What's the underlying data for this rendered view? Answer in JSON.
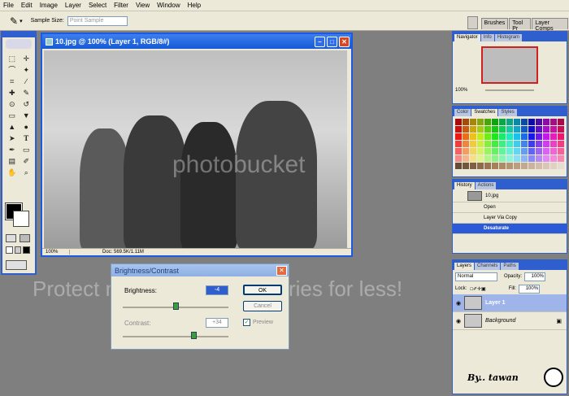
{
  "menu": [
    "File",
    "Edit",
    "Image",
    "Layer",
    "Select",
    "Filter",
    "View",
    "Window",
    "Help"
  ],
  "options": {
    "sample_size_label": "Sample Size:",
    "sample_size_value": "Point Sample"
  },
  "dock_tabs": [
    "Brushes",
    "Tool Pr",
    "Layer Comps"
  ],
  "document": {
    "title": "10.jpg @ 100% (Layer 1, RGB/8#)",
    "zoom": "100%",
    "doc_size": "Doc: 569.5K/1.11M"
  },
  "dialog": {
    "title": "Brightness/Contrast",
    "brightness_label": "Brightness:",
    "brightness_value": "-4",
    "contrast_label": "Contrast:",
    "contrast_value": "+34",
    "ok_label": "OK",
    "cancel_label": "Cancel",
    "preview_label": "Preview",
    "preview_checked": true
  },
  "watermark": {
    "text": "Protect more of your memories for less!",
    "logo": "photobucket"
  },
  "navigator": {
    "tabs": [
      "Navigator",
      "Info",
      "Histogram"
    ],
    "zoom": "100%"
  },
  "swatches": {
    "tabs": [
      "Color",
      "Swatches",
      "Styles"
    ]
  },
  "history": {
    "tabs": [
      "History",
      "Actions"
    ],
    "snapshot": "10.jpg",
    "items": [
      "Open",
      "Layer Via Copy",
      "Desaturate"
    ],
    "selected": "Desaturate"
  },
  "layers": {
    "tabs": [
      "Layers",
      "Channels",
      "Paths"
    ],
    "blend_mode": "Normal",
    "opacity_label": "Opacity:",
    "opacity": "100%",
    "lock_label": "Lock:",
    "fill_label": "Fill:",
    "fill": "100%",
    "items": [
      {
        "name": "Layer 1",
        "selected": true
      },
      {
        "name": "Background",
        "selected": false
      }
    ]
  },
  "signature": "By.. tawan",
  "colors": {
    "xp_blue": "#2f5fcf",
    "panel_bg": "#ece9d8",
    "workspace": "#7f7f7f"
  }
}
